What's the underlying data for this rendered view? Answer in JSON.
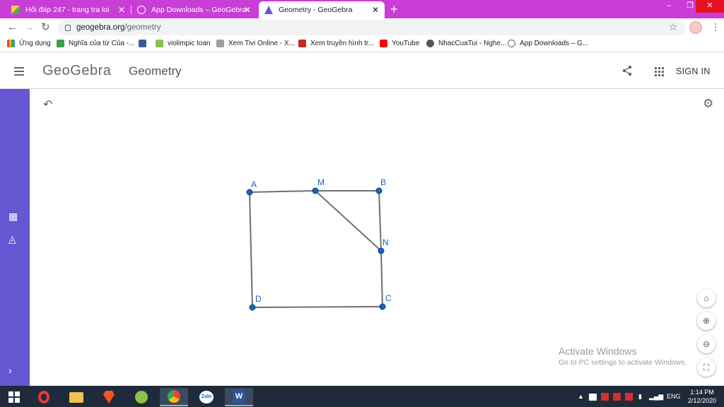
{
  "browser": {
    "tabs": [
      {
        "title": "Hỏi đáp 247 - trang tra loi",
        "active": false
      },
      {
        "title": "App Downloads – GeoGebra",
        "active": false
      },
      {
        "title": "Geometry - GeoGebra",
        "active": true
      }
    ],
    "url": {
      "host": "geogebra.org",
      "path": "/geometry"
    },
    "bookmarks": [
      {
        "label": "Ứng dụng",
        "icon": "apps-grid-icon"
      },
      {
        "label": "Nghĩa của từ Của -...",
        "icon": "dictionary-icon"
      },
      {
        "label": "",
        "icon": "facebook-icon"
      },
      {
        "label": "violimpic toan",
        "icon": "violympic-icon"
      },
      {
        "label": "Xem Tivi Online - X...",
        "icon": "tv-icon"
      },
      {
        "label": "Xem truyền hình tr...",
        "icon": "tv-red-icon"
      },
      {
        "label": "YouTube",
        "icon": "youtube-icon"
      },
      {
        "label": "NhacCuaTui - Nghe...",
        "icon": "music-icon"
      },
      {
        "label": "App Downloads – G...",
        "icon": "geogebra-icon"
      }
    ]
  },
  "app": {
    "logo": "GeoGebra",
    "title": "Geometry",
    "signin": "SIGN IN"
  },
  "construction": {
    "points": [
      {
        "label": "A"
      },
      {
        "label": "M"
      },
      {
        "label": "B"
      },
      {
        "label": "N"
      },
      {
        "label": "C"
      },
      {
        "label": "D"
      }
    ],
    "segments": [
      "AM",
      "MB",
      "BN",
      "NC",
      "CD",
      "DA",
      "MN"
    ],
    "point_color": "#1565c0",
    "segment_color": "#6f6f6f",
    "label_color": "#1565c0"
  },
  "watermark": {
    "line1": "Activate Windows",
    "line2": "Go to PC settings to activate Windows."
  },
  "taskbar": {
    "language": "ENG",
    "time": "1:14 PM",
    "date": "2/12/2020"
  }
}
